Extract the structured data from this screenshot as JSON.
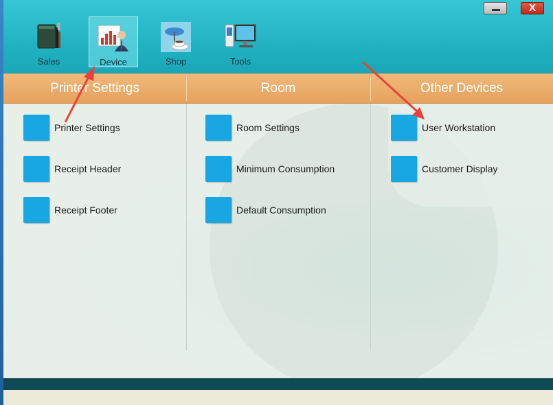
{
  "toolbar": {
    "items": [
      {
        "label": "Sales",
        "icon": "sales-book-icon"
      },
      {
        "label": "Device",
        "icon": "device-chart-icon"
      },
      {
        "label": "Shop",
        "icon": "shop-cafe-icon"
      },
      {
        "label": "Tools",
        "icon": "tools-computer-icon"
      }
    ],
    "active_index": 1
  },
  "window_controls": {
    "minimize_icon": "minimize-icon",
    "close_label": "X"
  },
  "sections": [
    {
      "title": "Printer Settings",
      "items": [
        "Printer Settings",
        "Receipt Header",
        "Receipt Footer"
      ]
    },
    {
      "title": "Room",
      "items": [
        "Room Settings",
        "Minimum Consumption",
        "Default Consumption"
      ]
    },
    {
      "title": "Other Devices",
      "items": [
        "User Workstation",
        "Customer Display"
      ]
    }
  ],
  "colors": {
    "toolbar": "#22b3c3",
    "header_band": "#e6a25d",
    "item_square": "#18a7e3",
    "annotation_arrow": "#e8433a"
  }
}
